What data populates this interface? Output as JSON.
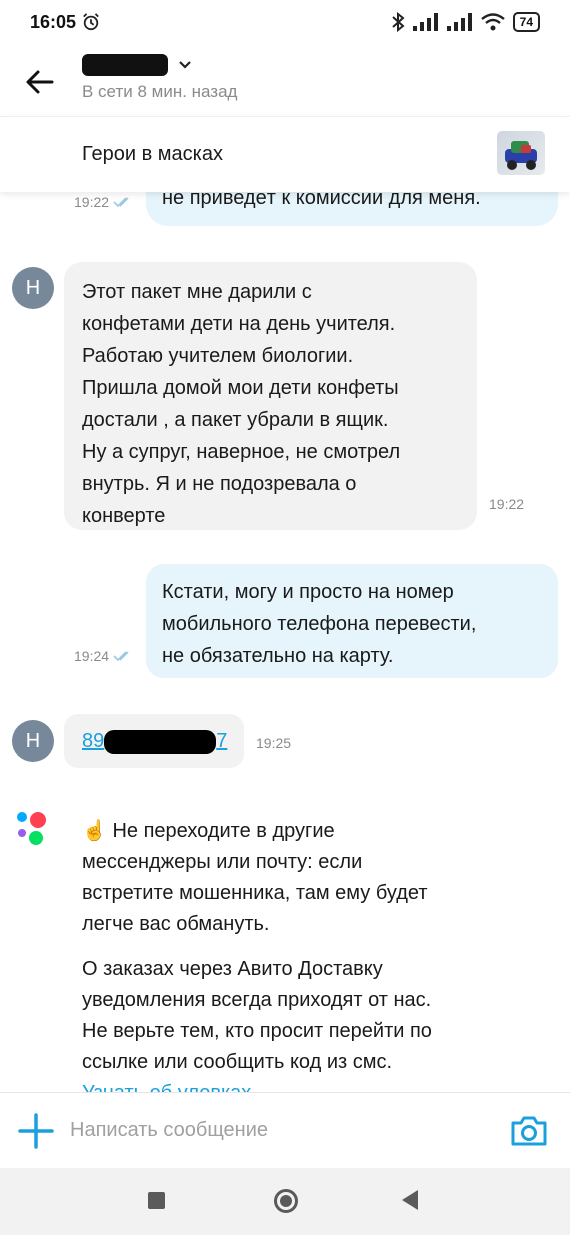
{
  "status_bar": {
    "time": "16:05",
    "battery": "74"
  },
  "header": {
    "status": "В сети 8 мин. назад"
  },
  "ad": {
    "title": "Герои в масках"
  },
  "messages": [
    {
      "direction": "out",
      "text": "не приведёт к комиссии для меня.",
      "time": "19:22"
    },
    {
      "direction": "in",
      "avatar": "Н",
      "lines": [
        "Этот пакет мне дарили с",
        "конфетами дети на день учителя.",
        "Работаю учителем биологии.",
        "Пришла домой мои дети конфеты",
        "достали , а пакет убрали в ящик.",
        "Ну а супруг, наверное, не смотрел",
        "внутрь. Я и не подозревала о",
        "конверте"
      ],
      "time": "19:22"
    },
    {
      "direction": "out",
      "lines": [
        "Кстати, могу и просто на номер",
        "мобильного телефона перевести,",
        "не обязательно на карту."
      ],
      "time": "19:24"
    },
    {
      "direction": "in",
      "avatar": "Н",
      "phone_prefix": "89",
      "phone_suffix": "7",
      "time": "19:25"
    }
  ],
  "system_notice": {
    "emoji": "☝️",
    "paragraph1": "Не переходите в другие мессенджеры или почту: если встретите мошенника, там ему будет легче вас обмануть.",
    "paragraph2": "О заказах через Авито Доставку уведомления всегда приходят от нас. Не верьте тем, кто просит перейти по ссылке или сообщить код из смс.",
    "link": "Узнать об уловках"
  },
  "input": {
    "placeholder": "Написать сообщение"
  },
  "colors": {
    "outgoing_bubble": "#e6f4fb",
    "incoming_bubble": "#f2f2f2",
    "accent": "#1aa0dc",
    "avatar": "#76889a"
  }
}
